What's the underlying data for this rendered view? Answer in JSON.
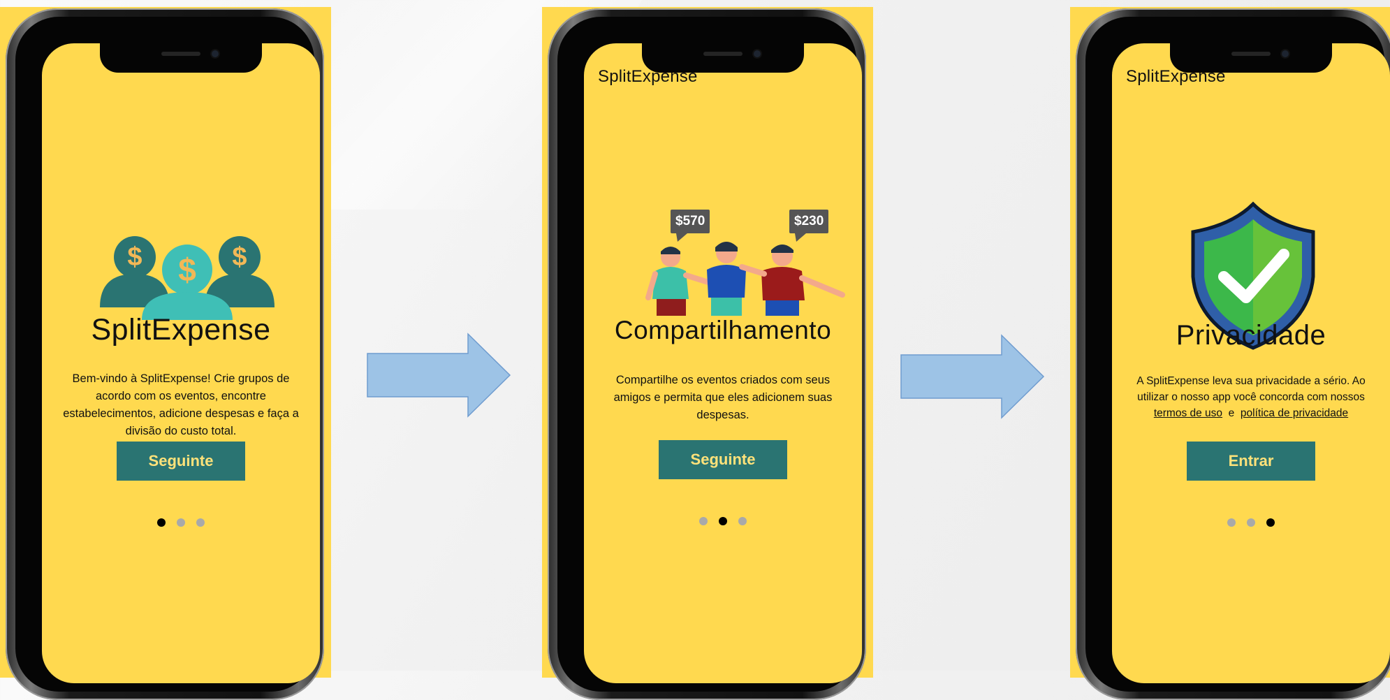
{
  "screens": [
    {
      "title": "SplitExpense",
      "description": "Bem-vindo à SplitExpense! Crie grupos de acordo com os eventos, encontre estabelecimentos, adicione despesas e faça a divisão do custo total.",
      "button_label": "Seguinte",
      "active_page": 1,
      "illustration": "money-people-icon"
    },
    {
      "app_name": "SplitExpense",
      "title": "Compartilhamento",
      "description": "Compartilhe os eventos criados com seus amigos e permita que eles adicionem suas despesas.",
      "price_tags": [
        "$570",
        "$230"
      ],
      "button_label": "Seguinte",
      "active_page": 2,
      "illustration": "friends-illustration"
    },
    {
      "app_name": "SplitExpense",
      "title": "Privacidade",
      "description": "A SplitExpense leva sua privacidade a sério. Ao utilizar o nosso app você concorda com nossos",
      "link_terms": "termos de uso",
      "link_joiner": "e",
      "link_privacy": "política de privacidade",
      "button_label": "Entrar",
      "active_page": 3,
      "illustration": "shield-check-icon"
    }
  ],
  "colors": {
    "screen_bg": "#ffd94f",
    "button_bg": "#2a7472",
    "button_text": "#ffe27a",
    "arrow_fill": "#9dc3e6"
  }
}
